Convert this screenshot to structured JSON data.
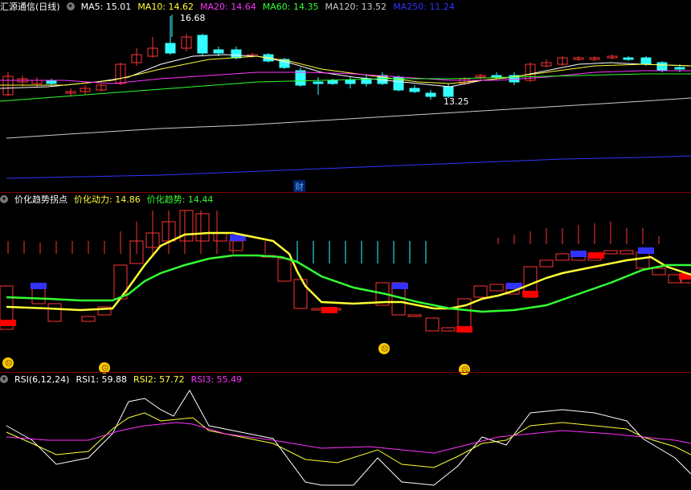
{
  "panel1": {
    "title": "汇源通信(日线)",
    "ma": [
      {
        "label": "MA5: 15.01",
        "color": "#ffffff"
      },
      {
        "label": "MA10: 14.62",
        "color": "#ffff33"
      },
      {
        "label": "MA20: 14.64",
        "color": "#ff33ff"
      },
      {
        "label": "MA60: 14.35",
        "color": "#33ff33"
      },
      {
        "label": "MA120: 13.52",
        "color": "#cccccc"
      },
      {
        "label": "MA250: 11.24",
        "color": "#3333ff"
      }
    ],
    "high_label": "16.68",
    "low_label": "13.25",
    "cai_label": "财"
  },
  "panel2": {
    "title": "价化趋势拐点",
    "dongli": "价化动力: 14.86",
    "qushi": "价化趋势: 14.44",
    "dongli_color": "#ffff33",
    "qushi_color": "#33ff33"
  },
  "panel3": {
    "title": "RSI(6,12,24)",
    "rsi1": "RSI1: 59.88",
    "rsi2": "RSI2: 57.72",
    "rsi3": "RSI3: 55.49",
    "rsi1_color": "#ffffff",
    "rsi2_color": "#ffff33",
    "rsi3_color": "#ff33ff"
  },
  "colors": {
    "up": "#ff3333",
    "down": "#33ffff",
    "down2": "#33ff33"
  }
}
